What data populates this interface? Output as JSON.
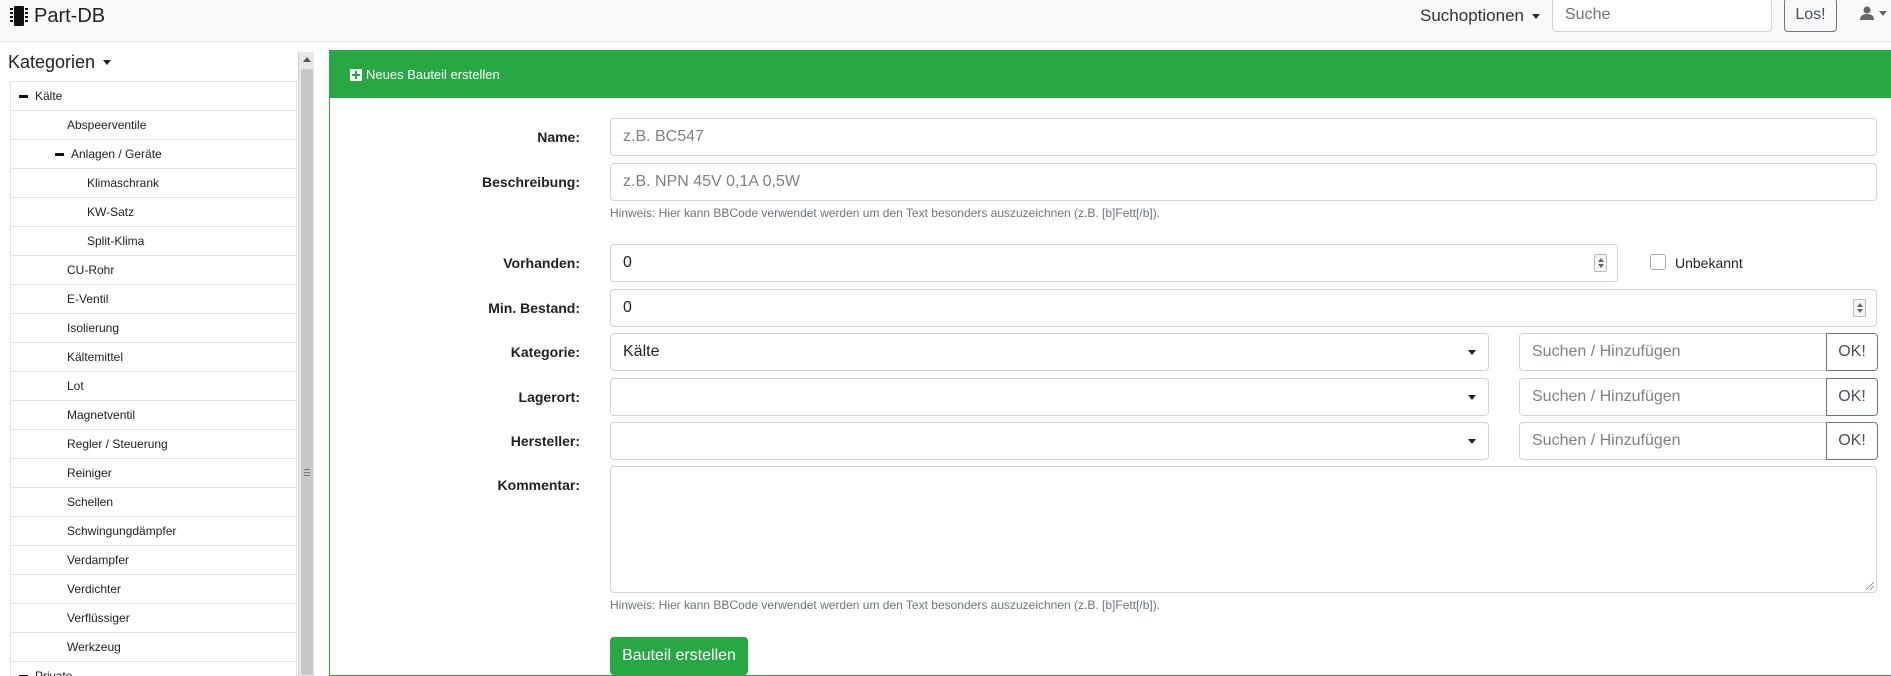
{
  "navbar": {
    "brand": "Part-DB",
    "search_options": "Suchoptionen",
    "search_placeholder": "Suche",
    "search_button": "Los!"
  },
  "sidebar": {
    "title": "Kategorien",
    "items": [
      {
        "label": "Kälte",
        "level": 0,
        "expanded": true
      },
      {
        "label": "Abspeerventile",
        "level": 1
      },
      {
        "label": "Anlagen / Geräte",
        "level": 1,
        "expanded": true
      },
      {
        "label": "Klimaschrank",
        "level": 2
      },
      {
        "label": "KW-Satz",
        "level": 2
      },
      {
        "label": "Split-Klima",
        "level": 2
      },
      {
        "label": "CU-Rohr",
        "level": 1
      },
      {
        "label": "E-Ventil",
        "level": 1
      },
      {
        "label": "Isolierung",
        "level": 1
      },
      {
        "label": "Kältemittel",
        "level": 1
      },
      {
        "label": "Lot",
        "level": 1
      },
      {
        "label": "Magnetventil",
        "level": 1
      },
      {
        "label": "Regler / Steuerung",
        "level": 1
      },
      {
        "label": "Reiniger",
        "level": 1
      },
      {
        "label": "Schellen",
        "level": 1
      },
      {
        "label": "Schwingungdämpfer",
        "level": 1
      },
      {
        "label": "Verdampfer",
        "level": 1
      },
      {
        "label": "Verdichter",
        "level": 1
      },
      {
        "label": "Verflüssiger",
        "level": 1
      },
      {
        "label": "Werkzeug",
        "level": 1
      },
      {
        "label": "Private",
        "level": 0,
        "expanded": true
      }
    ]
  },
  "card": {
    "title": "Neues Bauteil erstellen"
  },
  "form": {
    "name_label": "Name:",
    "name_placeholder": "z.B. BC547",
    "description_label": "Beschreibung:",
    "description_placeholder": "z.B. NPN 45V 0,1A 0,5W",
    "hint": "Hinweis: Hier kann BBCode verwendet werden um den Text besonders auszuzeichnen (z.B. [b]Fett[/b]).",
    "instock_label": "Vorhanden:",
    "instock_value": "0",
    "unknown_label": "Unbekannt",
    "unknown_checked": false,
    "mininstock_label": "Min. Bestand:",
    "mininstock_value": "0",
    "category_label": "Kategorie:",
    "category_value": "Kälte",
    "storelocation_label": "Lagerort:",
    "storelocation_value": "",
    "manufacturer_label": "Hersteller:",
    "manufacturer_value": "",
    "search_add_placeholder": "Suchen / Hinzufügen",
    "ok_label": "OK!",
    "comment_label": "Kommentar:",
    "submit_label": "Bauteil erstellen"
  },
  "colors": {
    "primary_green": "#28a745"
  },
  "icons": [
    "chip-icon",
    "caret-down-icon",
    "user-icon",
    "minus-icon",
    "plus-square-icon",
    "spinner-icon",
    "resize-grip-icon"
  ]
}
